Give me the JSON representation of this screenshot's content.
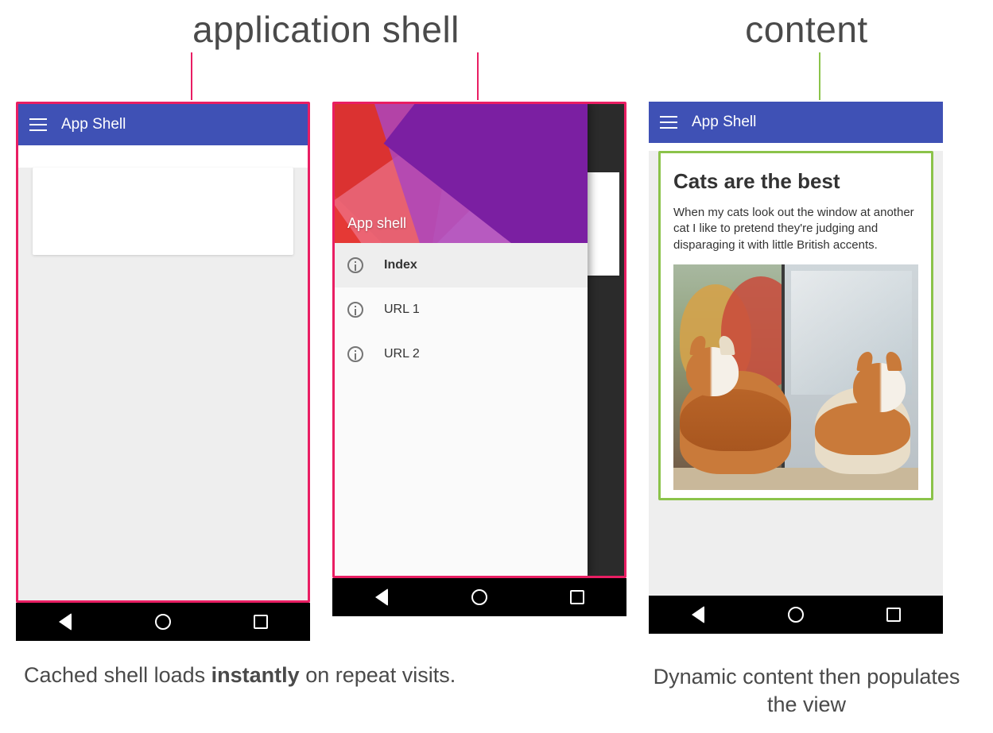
{
  "labels": {
    "shell": "application shell",
    "content": "content"
  },
  "phone1": {
    "appbar_title": "App Shell"
  },
  "phone2": {
    "drawer_header": "App shell",
    "items": [
      {
        "label": "Index",
        "active": true
      },
      {
        "label": "URL 1",
        "active": false
      },
      {
        "label": "URL 2",
        "active": false
      }
    ]
  },
  "phone3": {
    "appbar_title": "App Shell",
    "content_title": "Cats are the best",
    "content_body": "When my cats look out the window at another cat I like to pretend they're judging and disparaging it with little British accents."
  },
  "captions": {
    "left_pre": "Cached shell loads ",
    "left_strong": "instantly",
    "left_post": " on repeat visits.",
    "right": "Dynamic content then populates the view"
  },
  "colors": {
    "shell_outline": "#e91e63",
    "content_outline": "#8bc34a",
    "appbar": "#3f51b5"
  }
}
